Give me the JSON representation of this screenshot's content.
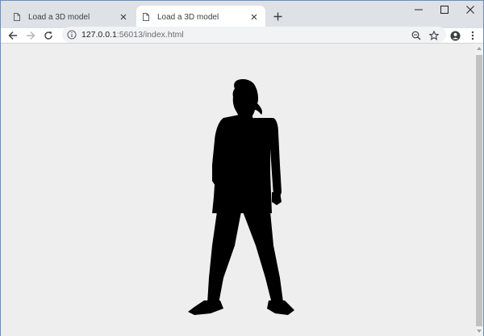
{
  "tabs": [
    {
      "title": "Load a 3D model",
      "icon": "document-icon",
      "active": false
    },
    {
      "title": "Load a 3D model",
      "icon": "document-icon",
      "active": true
    }
  ],
  "new_tab": {
    "symbol": "+"
  },
  "window_controls": {
    "minimize": "—",
    "maximize": "☐",
    "close": "✕"
  },
  "toolbar": {
    "url_host": "127.0.0.1",
    "url_rest": ":56013/index.html"
  },
  "viewport": {
    "background": "#eeeeee",
    "content": "silhouette-3d-model"
  },
  "colors": {
    "tabstrip": "#dee1e6",
    "active_tab": "#ffffff",
    "omnibox": "#f1f3f4",
    "model": "#000000"
  }
}
